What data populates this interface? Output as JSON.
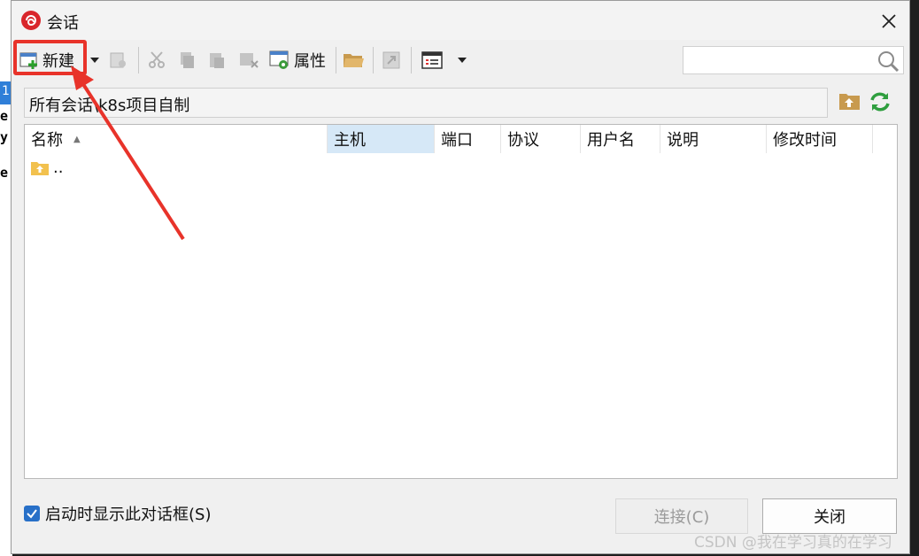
{
  "background": {
    "line_1": "e",
    "line_2": "y",
    "line_3": "e",
    "tab": "1"
  },
  "window": {
    "title": "会话",
    "icon": "app-logo-icon",
    "close_icon": "close-icon"
  },
  "toolbar": {
    "new_label": "新建",
    "properties_label": "属性",
    "items": [
      "new-session-icon",
      "dropdown-arrow-icon",
      "copy-disabled-icon",
      "cut-icon",
      "copy-icon",
      "paste-icon",
      "delete-icon",
      "properties-icon",
      "open-folder-icon",
      "export-icon",
      "view-icon",
      "view-dropdown-icon"
    ],
    "search_placeholder": ""
  },
  "path": {
    "text": "所有会话\\k8s项目自制"
  },
  "table": {
    "columns": [
      "名称",
      "主机",
      "端口",
      "协议",
      "用户名",
      "说明",
      "修改时间"
    ],
    "sorted_column": "名称",
    "highlighted_column": "主机",
    "rows": [
      {
        "name": ".."
      }
    ]
  },
  "footer": {
    "show_on_startup_label": "启动时显示此对话框(S)",
    "show_on_startup_checked": true,
    "connect_label": "连接(C)",
    "close_label": "关闭"
  },
  "watermark": "CSDN @我在学习真的在学习",
  "colors": {
    "accent": "#2870c8",
    "highlight_box": "#e8332a",
    "sorted_header": "#d6e8f7"
  }
}
